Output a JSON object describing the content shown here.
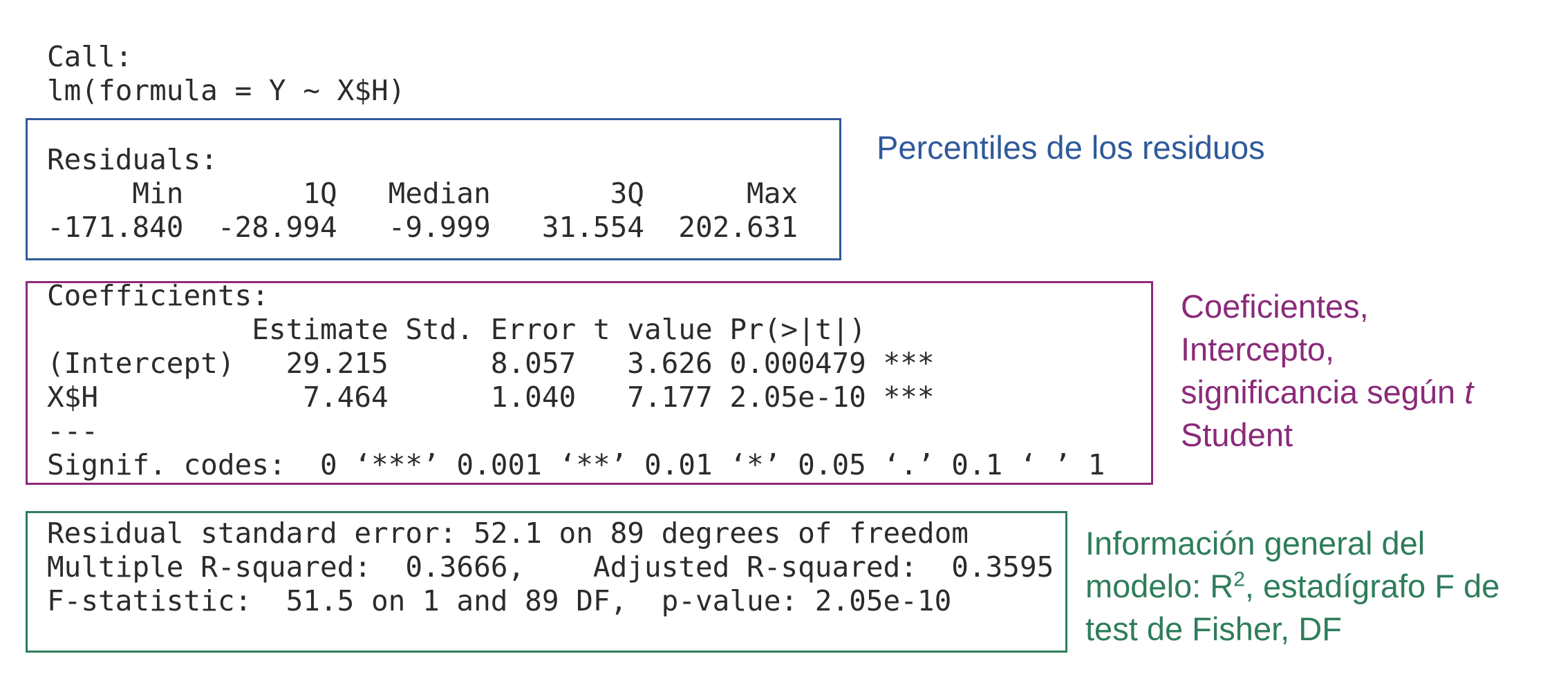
{
  "colors": {
    "residuals": "#2f5a9a",
    "coefficients": "#8b2a7a",
    "general": "#2e7d5b",
    "code_text": "#2b2b2b"
  },
  "call": {
    "label": "Call:",
    "formula": "lm(formula = Y ~ X$H)"
  },
  "residuals": {
    "label": "Residuals:",
    "header": "     Min       1Q   Median       3Q      Max",
    "values": "-171.840  -28.994   -9.999   31.554  202.631"
  },
  "coefficients": {
    "label": "Coefficients:",
    "header": "            Estimate Std. Error t value Pr(>|t|)",
    "rows": [
      "(Intercept)   29.215      8.057   3.626 0.000479 ***",
      "X$H            7.464      1.040   7.177 2.05e-10 ***"
    ],
    "separator": "---",
    "signif": "Signif. codes:  0 ‘***’ 0.001 ‘**’ 0.01 ‘*’ 0.05 ‘.’ 0.1 ‘ ’ 1"
  },
  "general": {
    "lines": [
      "Residual standard error: 52.1 on 89 degrees of freedom",
      "Multiple R-squared:  0.3666,    Adjusted R-squared:  0.3595",
      "F-statistic:  51.5 on 1 and 89 DF,  p-value: 2.05e-10"
    ]
  },
  "annotations": {
    "residuals": "Percentiles de los residuos",
    "coefficients": {
      "line1": "Coeficientes,",
      "line2": "Intercepto,",
      "line3_prefix": "significancia según ",
      "line3_italic": "t",
      "line4": "Student"
    },
    "general": {
      "line1": "Información general del",
      "line2_prefix": "modelo: R",
      "line2_sup": "2",
      "line2_suffix": ", estadígrafo F de",
      "line3": "test de Fisher, DF"
    }
  }
}
